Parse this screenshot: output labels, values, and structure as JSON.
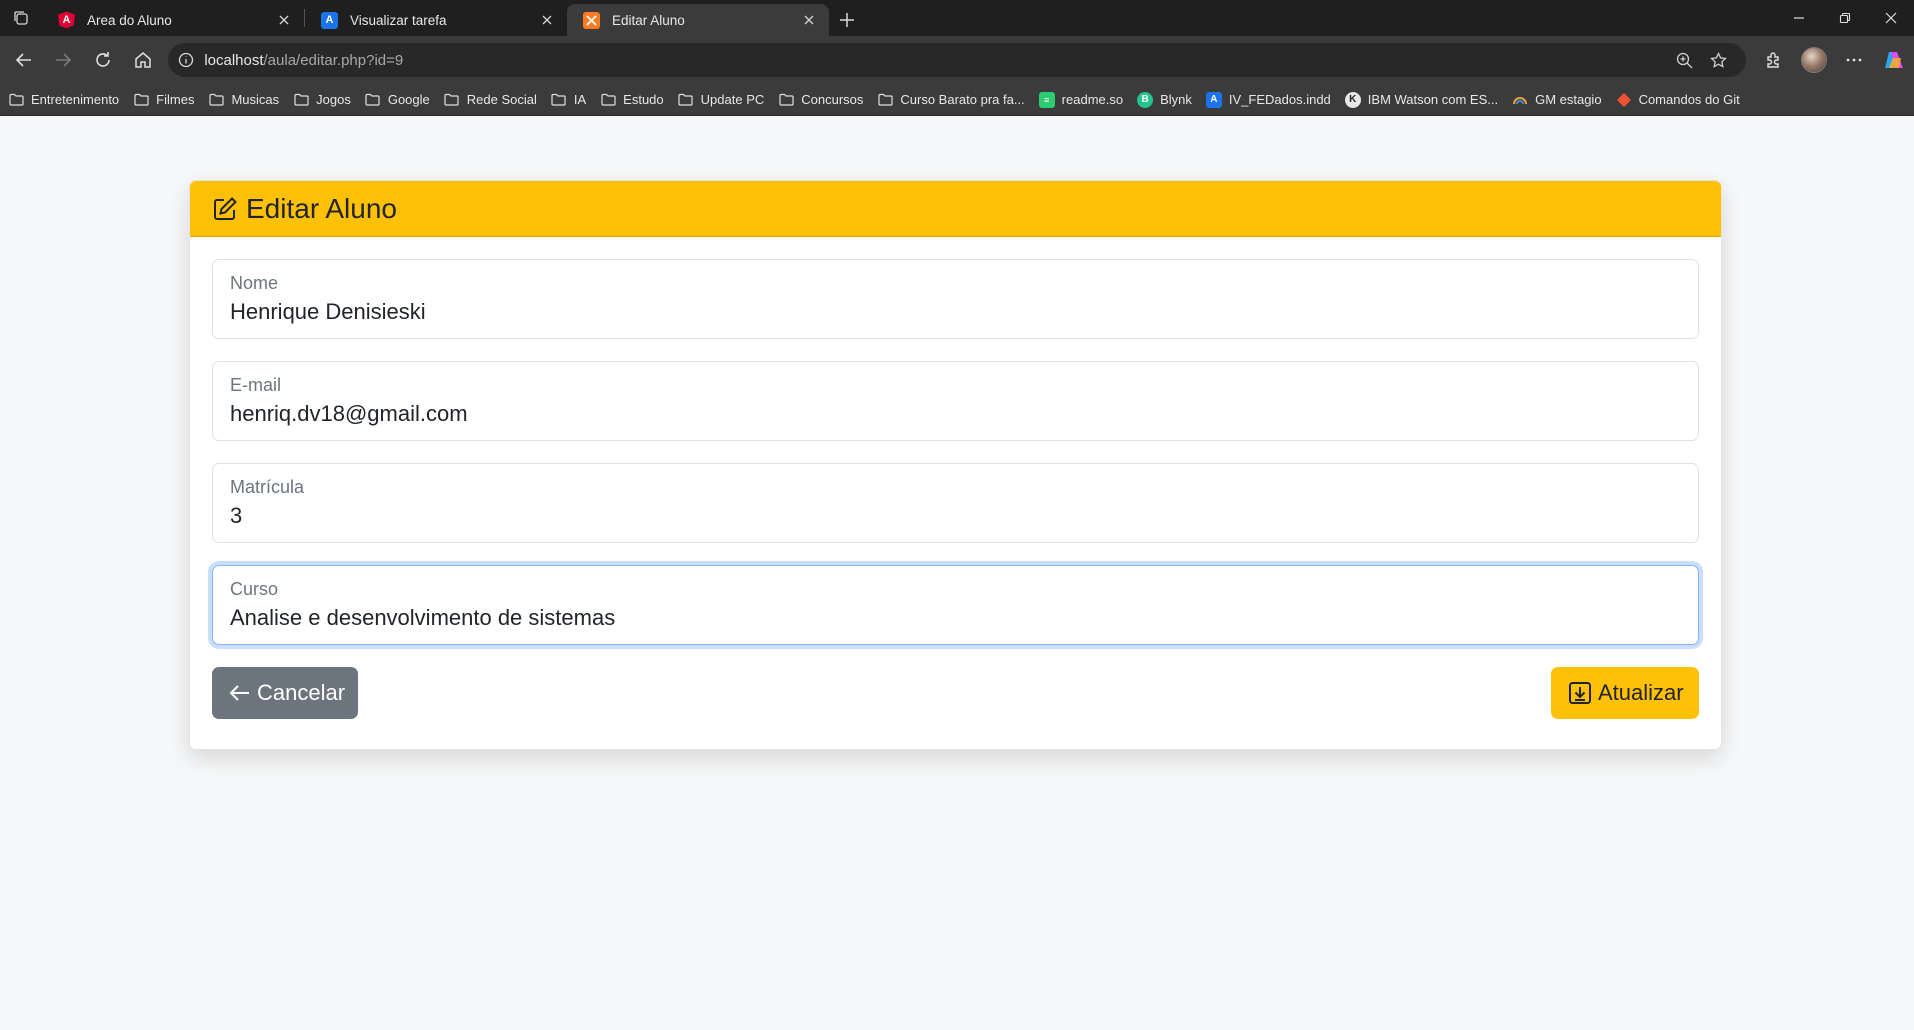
{
  "browser": {
    "tabs": [
      {
        "title": "Area do Aluno",
        "icon": "angular-icon",
        "color": "#dd0031"
      },
      {
        "title": "Visualizar tarefa",
        "icon": "a-icon",
        "color": "#1a73e8"
      },
      {
        "title": "Editar Aluno",
        "icon": "xampp-icon",
        "color": "#fb7a24"
      }
    ],
    "url_host": "localhost",
    "url_path": "/aula/editar.php?id=9",
    "bookmarks": [
      {
        "label": "Entretenimento",
        "icon": "folder-icon"
      },
      {
        "label": "Filmes",
        "icon": "folder-icon"
      },
      {
        "label": "Musicas",
        "icon": "folder-icon"
      },
      {
        "label": "Jogos",
        "icon": "folder-icon"
      },
      {
        "label": "Google",
        "icon": "folder-icon"
      },
      {
        "label": "Rede Social",
        "icon": "folder-icon"
      },
      {
        "label": "IA",
        "icon": "folder-icon"
      },
      {
        "label": "Estudo",
        "icon": "folder-icon"
      },
      {
        "label": "Update PC",
        "icon": "folder-icon"
      },
      {
        "label": "Concursos",
        "icon": "folder-icon"
      },
      {
        "label": "Curso Barato pra fa...",
        "icon": "folder-icon"
      },
      {
        "label": "readme.so",
        "icon": "readme-icon",
        "color": "#2ecc71"
      },
      {
        "label": "Blynk",
        "icon": "blynk-icon",
        "color": "#23c48e"
      },
      {
        "label": "IV_FEDados.indd",
        "icon": "a-icon",
        "color": "#1a73e8"
      },
      {
        "label": "IBM Watson com ES...",
        "icon": "watson-icon",
        "color": "#ffffff"
      },
      {
        "label": "GM estagio",
        "icon": "gm-icon",
        "color": "#e8a33d"
      },
      {
        "label": "Comandos do Git",
        "icon": "git-icon",
        "color": "#f05133"
      }
    ]
  },
  "page": {
    "header_title": "Editar Aluno",
    "fields": [
      {
        "label": "Nome",
        "value": "Henrique Denisieski"
      },
      {
        "label": "E-mail",
        "value": "henriq.dv18@gmail.com"
      },
      {
        "label": "Matrícula",
        "value": "3"
      },
      {
        "label": "Curso",
        "value": "Analise e desenvolvimento de sistemas"
      }
    ],
    "cancel_label": "Cancelar",
    "update_label": "Atualizar"
  },
  "colors": {
    "header": "#ffc107",
    "cancel_button": "#6c757d",
    "update_button": "#ffc107",
    "focus_ring": "#86b7fe"
  }
}
